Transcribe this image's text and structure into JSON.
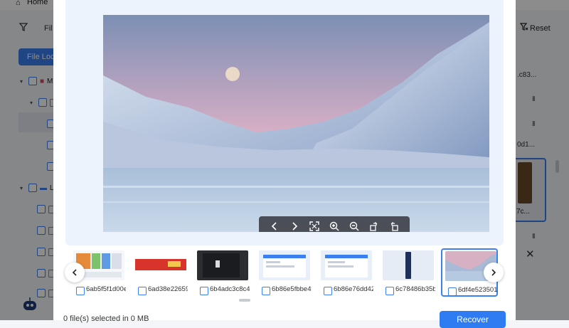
{
  "background": {
    "home_label": "Home",
    "filter_label": "Fil",
    "reset_label": "Reset",
    "file_location_button": "File Loc",
    "sidebar_labels": [
      "M",
      "L"
    ],
    "right_items": [
      ".c83...",
      "0d1...",
      "7c..."
    ]
  },
  "modal": {
    "toolbar": {
      "icons": [
        "chevron-left-icon",
        "chevron-right-icon",
        "fullscreen-icon",
        "zoom-in-icon",
        "zoom-out-icon",
        "rotate-right-icon",
        "rotate-left-icon"
      ]
    },
    "thumbnails": [
      {
        "name": "6ab5f5f1d00e...",
        "selected": false,
        "kind": "ui-screenshot"
      },
      {
        "name": "6ad38e22659...",
        "selected": false,
        "kind": "red-banner"
      },
      {
        "name": "6b4adc3c8c4...",
        "selected": false,
        "kind": "dark-window"
      },
      {
        "name": "6b86e5fbbe4f...",
        "selected": false,
        "kind": "light-window"
      },
      {
        "name": "6b86e76dd42...",
        "selected": false,
        "kind": "light-window"
      },
      {
        "name": "6c78486b35b...",
        "selected": false,
        "kind": "phone"
      },
      {
        "name": "6df4e5235011...",
        "selected": true,
        "kind": "mountain"
      }
    ],
    "footer": {
      "status": "0 file(s) selected in 0 MB",
      "recover_label": "Recover"
    }
  },
  "colors": {
    "accent": "#3b7ff0",
    "preview_bg": "#ecf3fd",
    "overlay": "rgba(0,0,0,0.45)"
  }
}
